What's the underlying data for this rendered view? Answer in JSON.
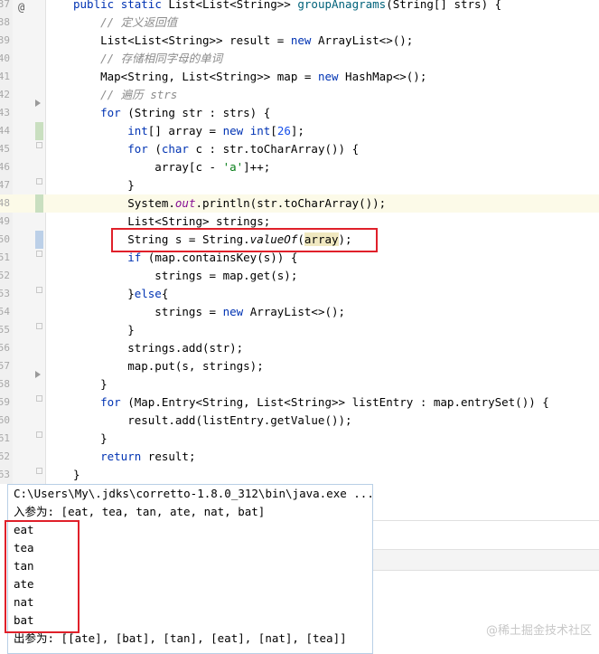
{
  "editor": {
    "lines": [
      {
        "num": "37",
        "tokens": [
          {
            "t": "public ",
            "c": "kw"
          },
          {
            "t": "static ",
            "c": "kw"
          },
          {
            "t": "List<List<String>> ",
            "c": ""
          },
          {
            "t": "groupAnagrams",
            "c": "mth"
          },
          {
            "t": "(String[] strs) {",
            "c": ""
          }
        ]
      },
      {
        "num": "38",
        "tokens": [
          {
            "t": "    // 定义返回值",
            "c": "cm"
          }
        ]
      },
      {
        "num": "39",
        "tokens": [
          {
            "t": "    List<List<String>> result = ",
            "c": ""
          },
          {
            "t": "new ",
            "c": "kw"
          },
          {
            "t": "ArrayList<>();",
            "c": ""
          }
        ]
      },
      {
        "num": "40",
        "tokens": [
          {
            "t": "    // 存储相同字母的单词",
            "c": "cm"
          }
        ]
      },
      {
        "num": "41",
        "tokens": [
          {
            "t": "    Map<String, List<String>> map = ",
            "c": ""
          },
          {
            "t": "new ",
            "c": "kw"
          },
          {
            "t": "HashMap<>();",
            "c": ""
          }
        ]
      },
      {
        "num": "42",
        "tokens": [
          {
            "t": "    // 遍历 strs",
            "c": "cm"
          }
        ]
      },
      {
        "num": "43",
        "tokens": [
          {
            "t": "    ",
            "c": ""
          },
          {
            "t": "for ",
            "c": "kw"
          },
          {
            "t": "(String str : strs) {",
            "c": ""
          }
        ]
      },
      {
        "num": "44",
        "tokens": [
          {
            "t": "        ",
            "c": ""
          },
          {
            "t": "int",
            "c": "kw"
          },
          {
            "t": "[] array = ",
            "c": ""
          },
          {
            "t": "new ",
            "c": "kw"
          },
          {
            "t": "int",
            "c": "kw"
          },
          {
            "t": "[",
            "c": ""
          },
          {
            "t": "26",
            "c": "num"
          },
          {
            "t": "];",
            "c": ""
          }
        ]
      },
      {
        "num": "45",
        "tokens": [
          {
            "t": "        ",
            "c": ""
          },
          {
            "t": "for ",
            "c": "kw"
          },
          {
            "t": "(",
            "c": ""
          },
          {
            "t": "char ",
            "c": "kw"
          },
          {
            "t": "c : str.toCharArray()) {",
            "c": ""
          }
        ]
      },
      {
        "num": "46",
        "tokens": [
          {
            "t": "            array[c - ",
            "c": ""
          },
          {
            "t": "'a'",
            "c": "str"
          },
          {
            "t": "]++;",
            "c": ""
          }
        ]
      },
      {
        "num": "47",
        "tokens": [
          {
            "t": "        }",
            "c": ""
          }
        ]
      },
      {
        "num": "48",
        "tokens": [
          {
            "t": "        System.",
            "c": ""
          },
          {
            "t": "out",
            "c": "fld"
          },
          {
            "t": ".println(str.toCharArray());",
            "c": ""
          }
        ]
      },
      {
        "num": "49",
        "tokens": [
          {
            "t": "        List<String> strings;",
            "c": ""
          }
        ]
      },
      {
        "num": "50",
        "tokens": [
          {
            "t": "        String s = String.",
            "c": ""
          },
          {
            "t": "valueOf",
            "c": "ital"
          },
          {
            "t": "(",
            "c": ""
          },
          {
            "t": "array",
            "c": "param-hl"
          },
          {
            "t": ");",
            "c": ""
          }
        ]
      },
      {
        "num": "51",
        "tokens": [
          {
            "t": "        ",
            "c": ""
          },
          {
            "t": "if ",
            "c": "kw"
          },
          {
            "t": "(map.containsKey(s)) {",
            "c": ""
          }
        ]
      },
      {
        "num": "52",
        "tokens": [
          {
            "t": "            strings = map.get(s);",
            "c": ""
          }
        ]
      },
      {
        "num": "53",
        "tokens": [
          {
            "t": "        }",
            "c": ""
          },
          {
            "t": "else",
            "c": "kw"
          },
          {
            "t": "{",
            "c": ""
          }
        ]
      },
      {
        "num": "54",
        "tokens": [
          {
            "t": "            strings = ",
            "c": ""
          },
          {
            "t": "new ",
            "c": "kw"
          },
          {
            "t": "ArrayList<>();",
            "c": ""
          }
        ]
      },
      {
        "num": "55",
        "tokens": [
          {
            "t": "        }",
            "c": ""
          }
        ]
      },
      {
        "num": "56",
        "tokens": [
          {
            "t": "        strings.add(str);",
            "c": ""
          }
        ]
      },
      {
        "num": "57",
        "tokens": [
          {
            "t": "        map.put(s, strings);",
            "c": ""
          }
        ]
      },
      {
        "num": "58",
        "tokens": [
          {
            "t": "    }",
            "c": ""
          }
        ]
      },
      {
        "num": "59",
        "tokens": [
          {
            "t": "    ",
            "c": ""
          },
          {
            "t": "for ",
            "c": "kw"
          },
          {
            "t": "(Map.Entry<String, List<String>> listEntry : map.entrySet()) {",
            "c": ""
          }
        ]
      },
      {
        "num": "60",
        "tokens": [
          {
            "t": "        result.add(listEntry.getValue());",
            "c": ""
          }
        ]
      },
      {
        "num": "61",
        "tokens": [
          {
            "t": "    }",
            "c": ""
          }
        ]
      },
      {
        "num": "62",
        "tokens": [
          {
            "t": "    ",
            "c": ""
          },
          {
            "t": "return ",
            "c": "kw"
          },
          {
            "t": "result;",
            "c": ""
          }
        ]
      },
      {
        "num": "63",
        "tokens": [
          {
            "t": "}",
            "c": ""
          }
        ]
      }
    ]
  },
  "console": {
    "lines": [
      "C:\\Users\\My\\.jdks\\corretto-1.8.0_312\\bin\\java.exe ...",
      "入参为: [eat, tea, tan, ate, nat, bat]",
      "eat",
      "tea",
      "tan",
      "ate",
      "nat",
      "bat",
      "出参为: [[ate], [bat], [tan], [eat], [nat], [tea]]"
    ]
  },
  "watermark": "@稀土掘金技术社区",
  "colors": {
    "highlight_box": "#e0202a",
    "keyword": "#0033b3",
    "comment": "#8c8c8c"
  }
}
